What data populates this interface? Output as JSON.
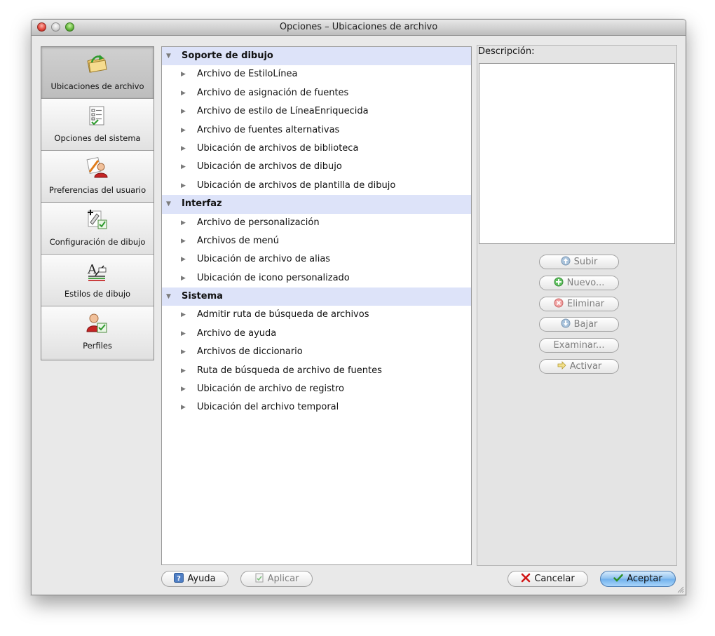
{
  "window": {
    "title": "Opciones – Ubicaciones de archivo"
  },
  "categories": [
    {
      "label": "Ubicaciones de archivo",
      "icon": "folder-arrow-icon",
      "selected": true
    },
    {
      "label": "Opciones del sistema",
      "icon": "checklist-icon",
      "selected": false
    },
    {
      "label": "Preferencias del usuario",
      "icon": "user-pencil-icon",
      "selected": false
    },
    {
      "label": "Configuración de dibujo",
      "icon": "drawing-config-icon",
      "selected": false
    },
    {
      "label": "Estilos de dibujo",
      "icon": "text-style-icon",
      "selected": false
    },
    {
      "label": "Perfiles",
      "icon": "profile-user-icon",
      "selected": false
    }
  ],
  "tree": {
    "groups": [
      {
        "label": "Soporte de dibujo",
        "items": [
          "Archivo de EstiloLínea",
          "Archivo de asignación de fuentes",
          "Archivo de estilo de LíneaEnriquecida",
          "Archivo de fuentes alternativas",
          "Ubicación de archivos de biblioteca",
          "Ubicación de archivos de dibujo",
          "Ubicación de archivos de plantilla de dibujo"
        ]
      },
      {
        "label": "Interfaz",
        "items": [
          "Archivo de personalización",
          "Archivos de menú",
          "Ubicación de archivo de alias",
          "Ubicación de icono personalizado"
        ]
      },
      {
        "label": "Sistema",
        "items": [
          "Admitir ruta de búsqueda de archivos",
          "Archivo de ayuda",
          "Archivos de diccionario",
          "Ruta de búsqueda de archivo de fuentes",
          "Ubicación de archivo de registro",
          "Ubicación del archivo temporal"
        ]
      }
    ]
  },
  "description": {
    "label": "Descripción:",
    "text": ""
  },
  "side_buttons": [
    {
      "label": "Subir",
      "icon": "arrow-up-icon"
    },
    {
      "label": "Nuevo...",
      "icon": "plus-icon"
    },
    {
      "label": "Eliminar",
      "icon": "delete-icon"
    },
    {
      "label": "Bajar",
      "icon": "arrow-down-icon"
    },
    {
      "label": "Examinar...",
      "icon": ""
    },
    {
      "label": "Activar",
      "icon": "arrow-right-icon"
    }
  ],
  "footer": {
    "help_label": "Ayuda",
    "apply_label": "Aplicar",
    "cancel_label": "Cancelar",
    "ok_label": "Aceptar"
  },
  "colors": {
    "group_header_bg": "#dde3f9",
    "default_button": "#8cc0ef",
    "cancel_x": "#d01515",
    "ok_check": "#2c8f23"
  }
}
